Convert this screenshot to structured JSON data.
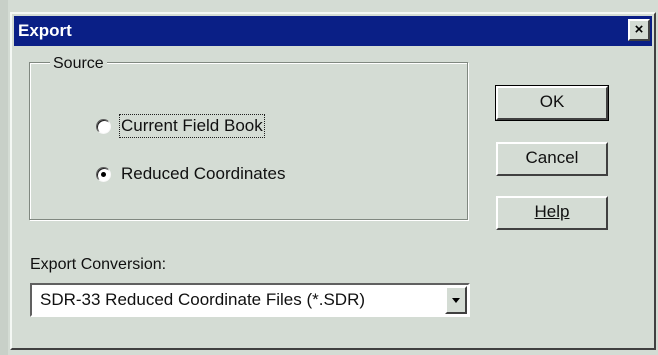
{
  "dialog": {
    "title": "Export",
    "close_glyph": "×"
  },
  "source": {
    "label": "Source",
    "options": [
      {
        "label": "Current Field Book",
        "selected": false,
        "focused": true
      },
      {
        "label": "Reduced Coordinates",
        "selected": true,
        "focused": false
      }
    ]
  },
  "buttons": {
    "ok": "OK",
    "cancel": "Cancel",
    "help": "Help"
  },
  "conversion": {
    "label": "Export Conversion:",
    "selected": "SDR-33 Reduced Coordinate Files (*.SDR)"
  },
  "colors": {
    "titlebar": "#0a1f86",
    "face": "#d4dcd4"
  },
  "icons": {
    "close": "close-icon",
    "dropdown": "chevron-down-icon"
  }
}
